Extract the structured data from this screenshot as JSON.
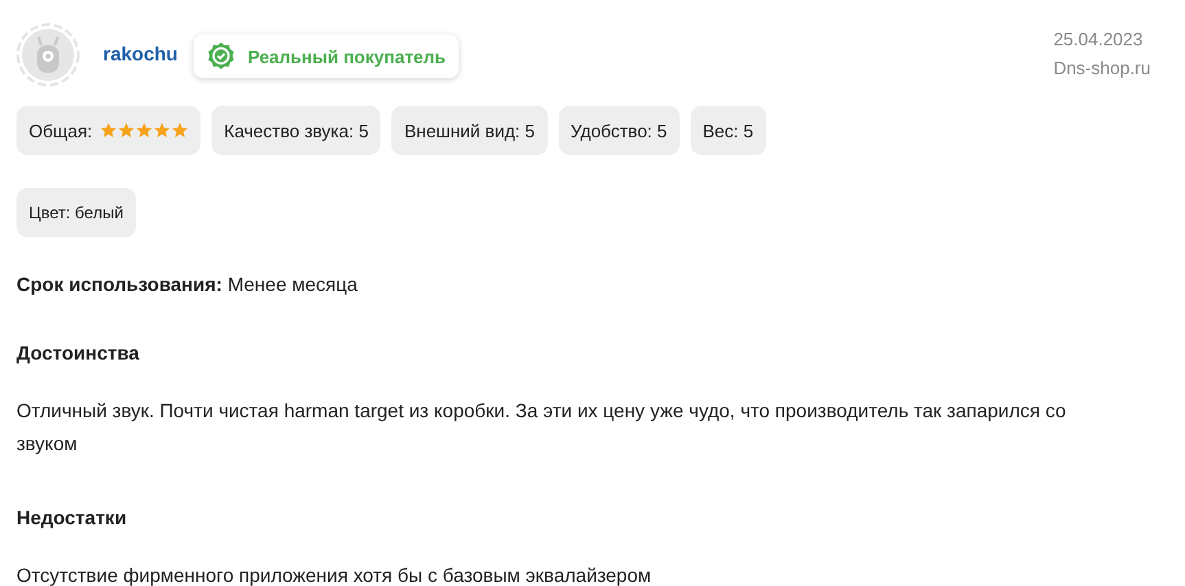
{
  "author": {
    "name": "rakochu",
    "badge": "Реальный покупатель"
  },
  "date": "25.04.2023",
  "source": "Dns-shop.ru",
  "ratings": [
    {
      "kind": "stars",
      "label": "Общая:",
      "stars": 5
    },
    {
      "kind": "score",
      "label": "Качество звука: 5"
    },
    {
      "kind": "score",
      "label": "Внешний вид: 5"
    },
    {
      "kind": "score",
      "label": "Удобство: 5"
    },
    {
      "kind": "score",
      "label": "Вес: 5"
    }
  ],
  "tags": [
    "Цвет: белый"
  ],
  "usage": {
    "label": "Срок использования:",
    "value": "Менее месяца"
  },
  "sections": [
    {
      "heading": "Достоинства",
      "text": "Отличный звук. Почти чистая harman target из коробки. За эти их цену уже чудо, что производитель так запарился со звуком"
    },
    {
      "heading": "Недостатки",
      "text": "Отсутствие фирменного приложения хотя бы с базовым эквалайзером"
    }
  ]
}
